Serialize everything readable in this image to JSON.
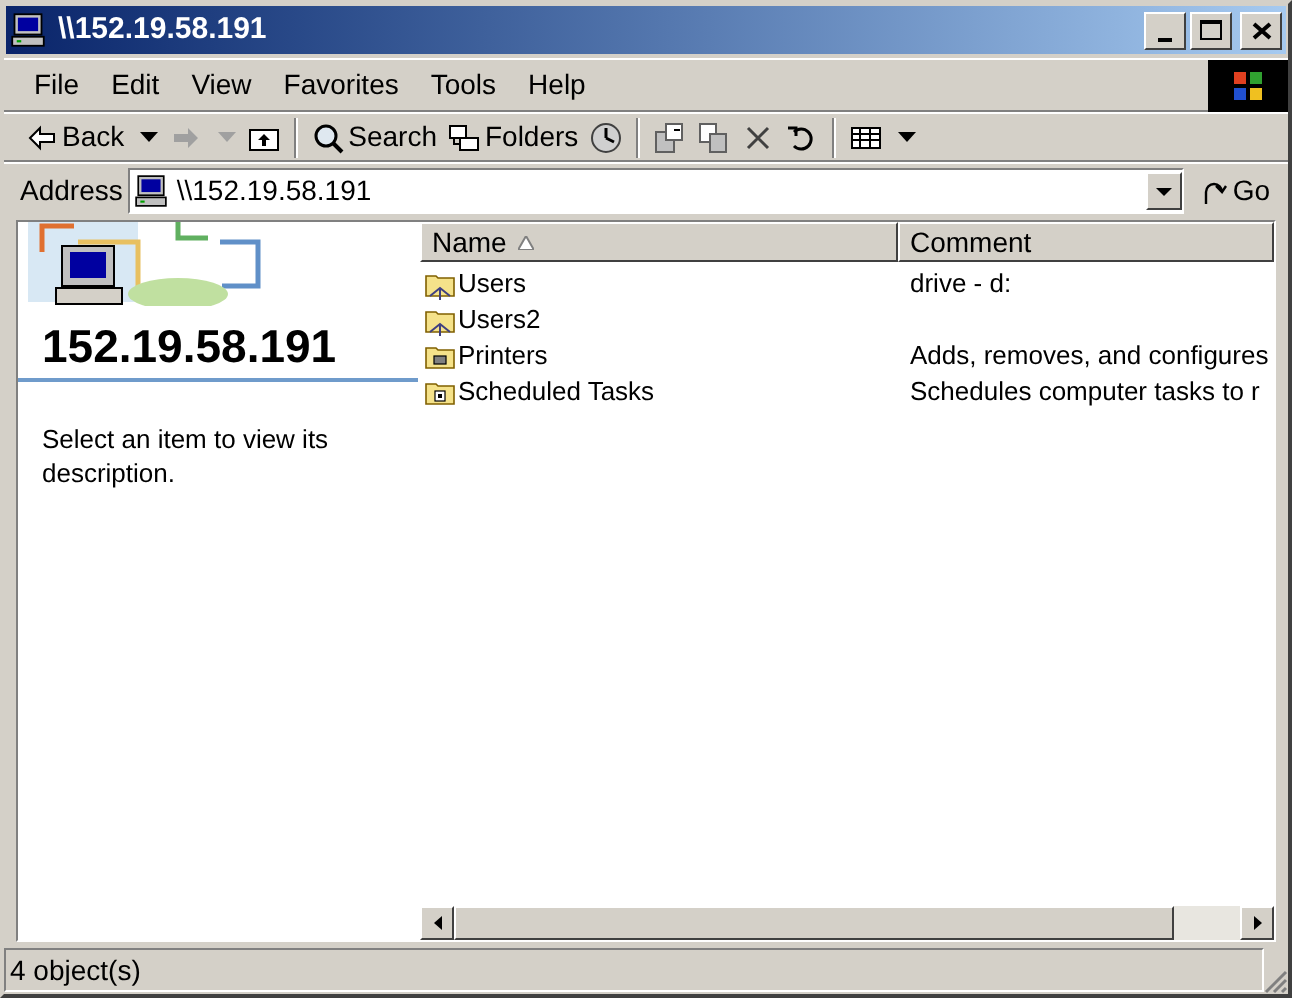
{
  "window": {
    "title": "\\\\152.19.58.191"
  },
  "menu": [
    "File",
    "Edit",
    "View",
    "Favorites",
    "Tools",
    "Help"
  ],
  "toolbar": [
    {
      "kind": "back",
      "label": "Back",
      "disabled": false
    },
    {
      "kind": "forward",
      "disabled": true
    },
    {
      "kind": "up",
      "disabled": false
    },
    {
      "kind": "separator"
    },
    {
      "kind": "search",
      "label": "Search",
      "disabled": false
    },
    {
      "kind": "folders",
      "label": "Folders",
      "disabled": false
    },
    {
      "kind": "history",
      "disabled": false
    },
    {
      "kind": "separator"
    },
    {
      "kind": "moveto",
      "disabled": false
    },
    {
      "kind": "copyto",
      "disabled": false
    },
    {
      "kind": "delete",
      "disabled": false
    },
    {
      "kind": "undo",
      "disabled": false
    },
    {
      "kind": "separator"
    },
    {
      "kind": "views",
      "disabled": false
    }
  ],
  "address": {
    "label": "Address",
    "value": "\\\\152.19.58.191",
    "go": "Go"
  },
  "info_panel": {
    "title": "152.19.58.191",
    "description": "Select an item to view its description."
  },
  "list": {
    "columns": [
      {
        "label": "Name",
        "sorted": true
      },
      {
        "label": "Comment",
        "sorted": false
      }
    ],
    "rows": [
      {
        "kind": "share",
        "name": "Users",
        "comment": "drive - d:"
      },
      {
        "kind": "share",
        "name": "Users2"
      },
      {
        "kind": "printers",
        "name": "Printers",
        "comment": "Adds, removes, and configures"
      },
      {
        "kind": "tasks",
        "name": "Scheduled Tasks",
        "comment": "Schedules computer tasks to r"
      }
    ]
  },
  "status_bar": "4 object(s)"
}
